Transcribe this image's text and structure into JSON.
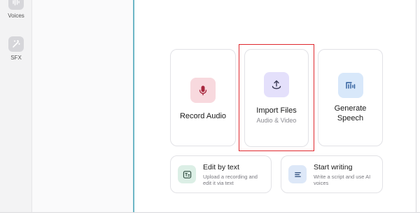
{
  "rail": {
    "items": [
      {
        "label": "Voices",
        "icon": "voices-icon"
      },
      {
        "label": "SFX",
        "icon": "sfx-icon"
      }
    ]
  },
  "cards": {
    "record": {
      "title": "Record Audio",
      "icon": "microphone-icon"
    },
    "import": {
      "title": "Import Files",
      "subtitle": "Audio & Video",
      "icon": "upload-icon"
    },
    "generate": {
      "title_line1": "Generate",
      "title_line2": "Speech",
      "icon": "speech-wave-icon"
    },
    "edit": {
      "title": "Edit by text",
      "subtitle": "Upload a recording and edit it via text",
      "icon": "text-edit-icon"
    },
    "write": {
      "title": "Start writing",
      "subtitle": "Write a script and use AI voices",
      "icon": "document-lines-icon"
    }
  },
  "colors": {
    "highlight": "#e0282e",
    "divider": "#6db6c6",
    "record_bg": "#f8d9de",
    "import_bg": "#e4e0fb",
    "generate_bg": "#d8e8fa"
  }
}
